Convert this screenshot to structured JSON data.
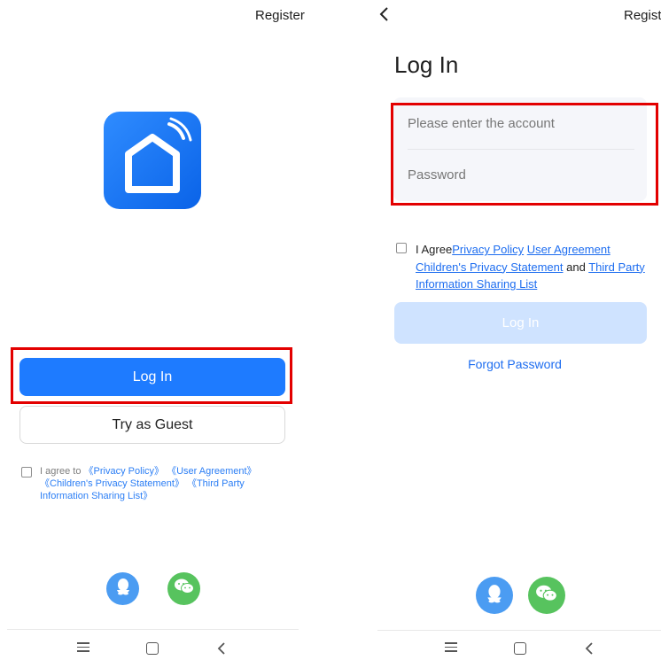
{
  "left": {
    "register_label": "Register",
    "login_label": "Log In",
    "guest_label": "Try as Guest",
    "agree": {
      "prefix": "I agree to",
      "links": [
        "《Privacy Policy》",
        "《User Agreement》",
        "《Children's Privacy Statement》",
        "《Third Party Information Sharing List》"
      ]
    }
  },
  "right": {
    "register_label": "Registe",
    "title": "Log In",
    "account_placeholder": "Please enter the account",
    "password_placeholder": "Password",
    "agree": {
      "prefix": "I Agree",
      "privacy": "Privacy Policy",
      "user": "User Agreement",
      "children": "Children's Privacy Statement",
      "and": "and",
      "third": "Third Party Information Sharing List"
    },
    "login_label": "Log In",
    "forgot_label": "Forgot Password"
  },
  "icons": [
    "back-icon",
    "app-logo-icon",
    "qq-icon",
    "wechat-icon",
    "menu-icon",
    "home-icon",
    "back-nav-icon"
  ],
  "colors": {
    "primary": "#1e7bff",
    "disabled": "#cfe3ff",
    "link": "#1d6df0",
    "highlight": "#e30000",
    "qq": "#4b9cf2",
    "wechat": "#57c35e"
  }
}
